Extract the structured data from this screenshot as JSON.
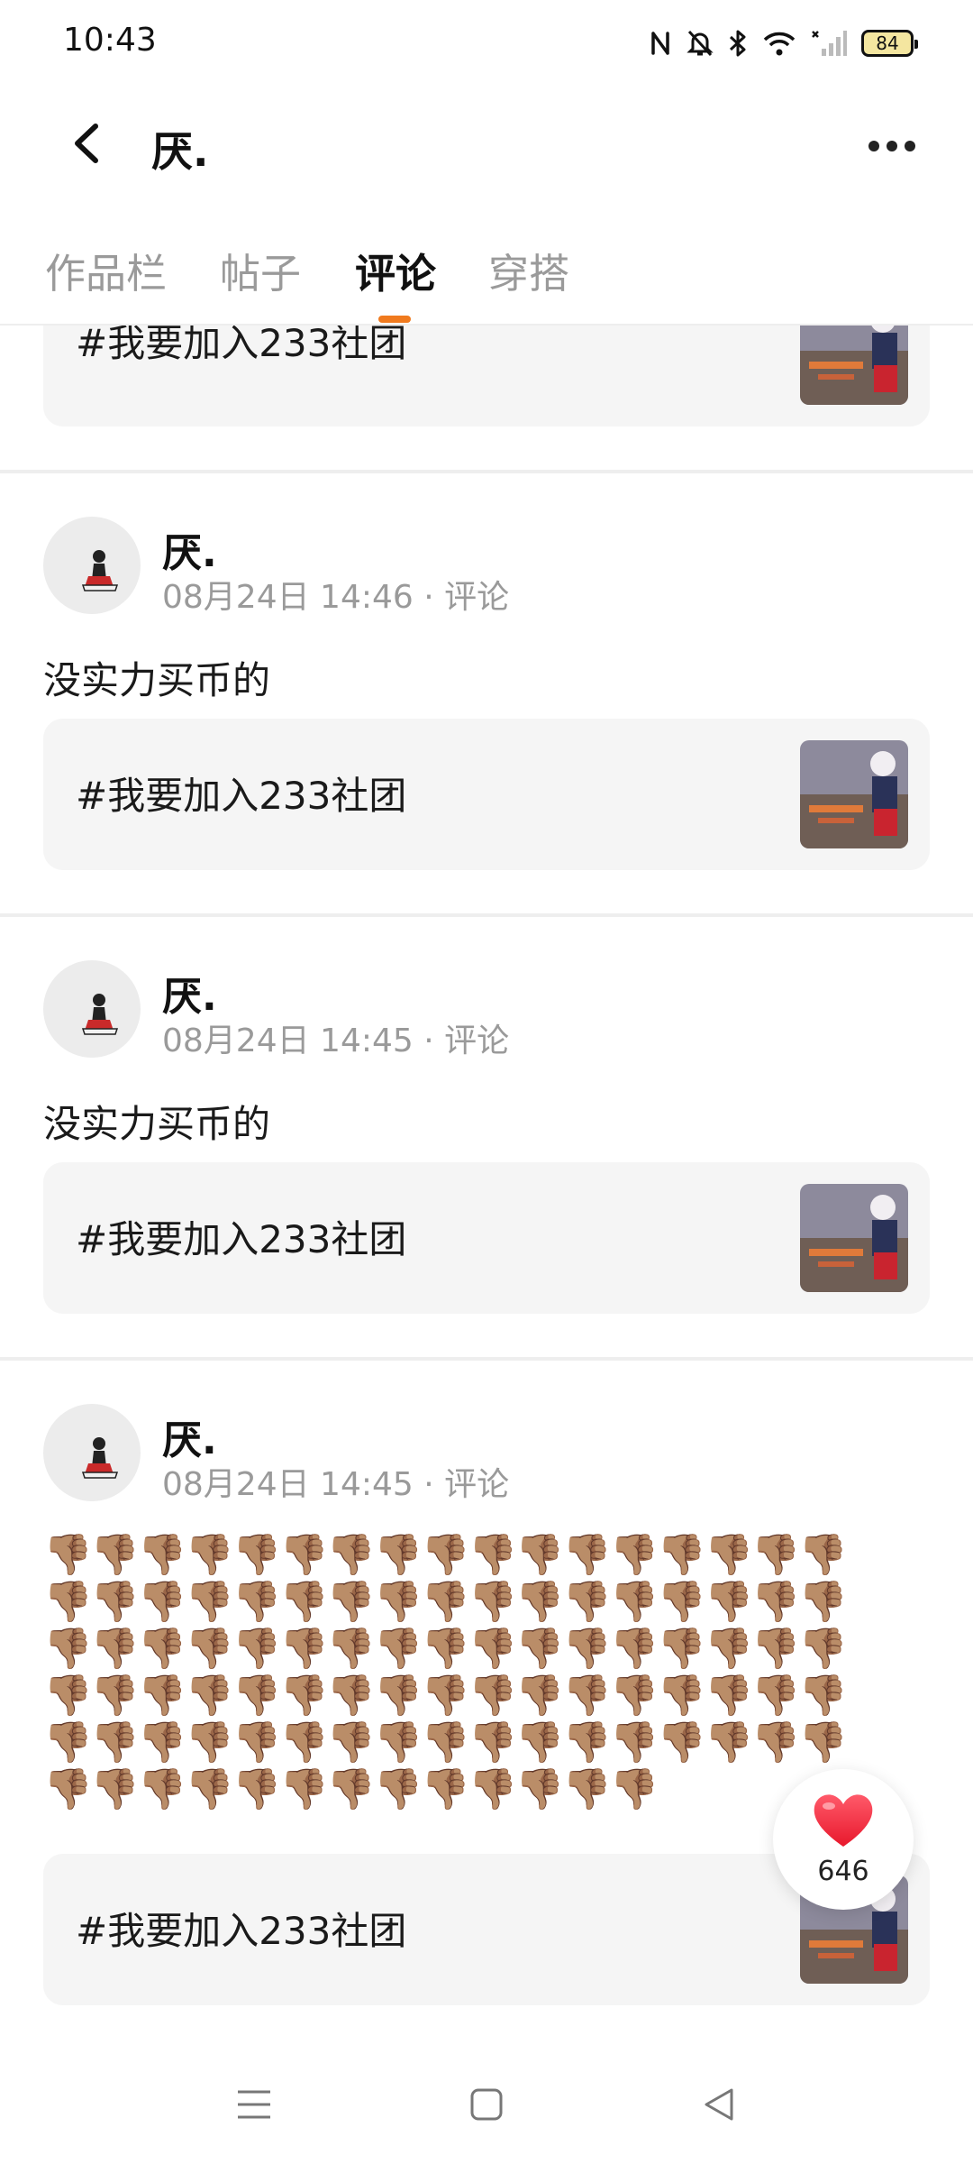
{
  "status_bar": {
    "time": "10:43",
    "battery": "84",
    "icons": [
      "nfc-icon",
      "bell-off-icon",
      "bluetooth-icon",
      "wifi-icon",
      "signal-icon",
      "battery-icon"
    ]
  },
  "header": {
    "title": "厌.",
    "back_icon": "chevron-left-icon",
    "more_icon": "more-horizontal-icon"
  },
  "tabs": [
    {
      "label": "作品栏",
      "active": false
    },
    {
      "label": "帖子",
      "active": false
    },
    {
      "label": "评论",
      "active": true
    },
    {
      "label": "穿搭",
      "active": false
    }
  ],
  "accent_color": "#f07a1e",
  "feed": {
    "partial_card_text": "#我要加入233社团",
    "posts": [
      {
        "username": "厌.",
        "meta": "08月24日 14:46 · 评论",
        "text": "没实力买币的",
        "card_text": "#我要加入233社团"
      },
      {
        "username": "厌.",
        "meta": "08月24日 14:45 · 评论",
        "text": "没实力买币的",
        "card_text": "#我要加入233社团"
      },
      {
        "username": "厌.",
        "meta": "08月24日 14:45 · 评论",
        "emoji": "👎🏽",
        "emoji_count": 98,
        "card_text": "#我要加入233社团"
      }
    ]
  },
  "like": {
    "count": "646",
    "icon": "heart-icon"
  },
  "nav": {
    "menu_icon": "menu-icon",
    "home_icon": "square-icon",
    "back_icon": "triangle-back-icon"
  }
}
